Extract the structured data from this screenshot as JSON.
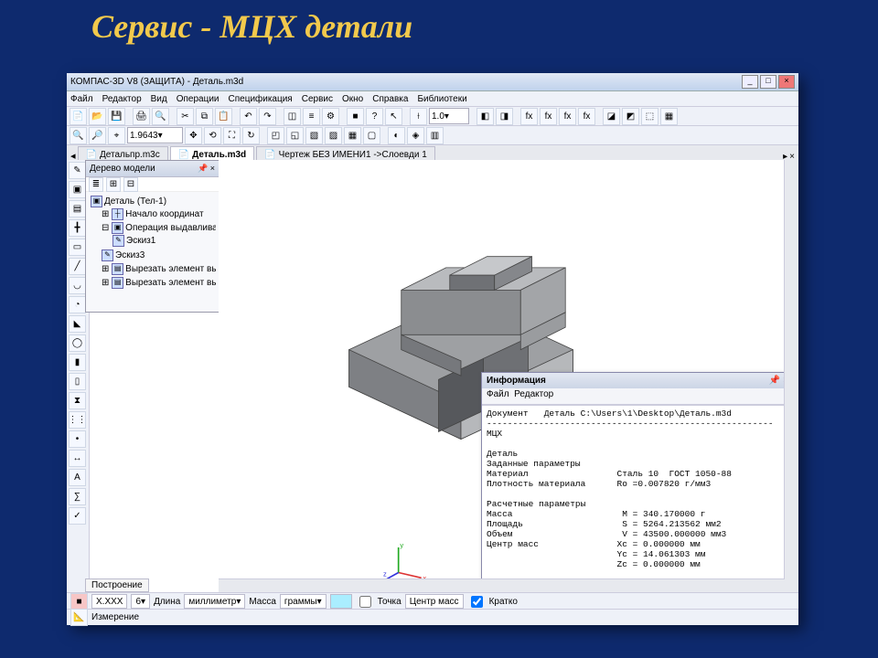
{
  "slide": {
    "title": "Сервис - МЦХ детали"
  },
  "titlebar": {
    "text": "КОМПАС-3D V8 (ЗАЩИТА) - Деталь.m3d"
  },
  "menu": {
    "file": "Файл",
    "edit": "Редактор",
    "view": "Вид",
    "ops": "Операции",
    "spec": "Спецификация",
    "service": "Сервис",
    "window": "Окно",
    "help": "Справка",
    "libs": "Библиотеки"
  },
  "toolbar": {
    "scale": "1.9643",
    "zoom": "1.0"
  },
  "tabs": {
    "t1": "Детальпр.m3с",
    "t2": "Деталь.m3d",
    "t3": "Чертеж БЕЗ ИМЕНИ1 ->Слоевди 1"
  },
  "tree": {
    "title": "Дерево модели",
    "root": "Деталь (Тел-1)",
    "n1": "Начало координат",
    "n2": "Операция выдавливания",
    "n2a": "Эскиз1",
    "n3": "Эскиз3",
    "n4": "Вырезать элемент выдав",
    "n5": "Вырезать элемент выдав"
  },
  "bottom_tab": "Построение",
  "bottombar": {
    "fmt": "X.XXX",
    "prec": "6",
    "unit_l": "Длина",
    "unit_lval": "миллиметр",
    "unit_m": "Масса",
    "unit_mval": "граммы",
    "pt": "Точка",
    "cm": "Центр масс",
    "brief": "Кратко"
  },
  "bottombar2": {
    "meas": "Измерение"
  },
  "info": {
    "title": "Информация",
    "menu_file": "Файл",
    "menu_edit": "Редактор",
    "body": "Документ   Деталь C:\\Users\\1\\Desktop\\Деталь.m3d\n-------------------------------------------------------\nМЦХ\n\nДеталь\nЗаданные параметры\nМатериал                 Сталь 10  ГОСТ 1050-88\nПлотность материала      Ro =0.007820 г/мм3\n\nРасчетные параметры\nМасса                     M = 340.170000 г\nПлощадь                   S = 5264.213562 мм2\nОбъем                     V = 43500.000000 мм3\nЦентр масс               Xc = 0.000000 мм\n                         Yc = 14.061303 мм\n                         Zc = 0.000000 мм"
  }
}
